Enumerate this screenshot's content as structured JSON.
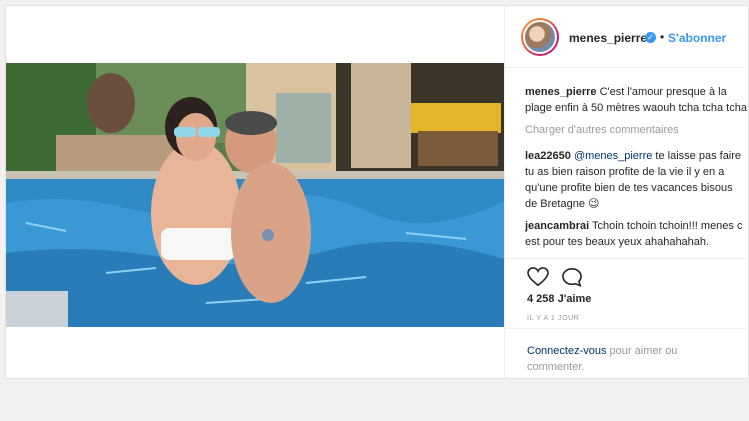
{
  "post": {
    "username": "menes_pierre",
    "follow_label": "S'abonner",
    "separator": "•",
    "verified_glyph": "✓",
    "icons": {
      "avatar": "avatar-image",
      "verified": "verified-badge-icon",
      "like": "heart-icon",
      "comment": "comment-bubble-icon",
      "save": "bookmark-icon",
      "more": "more-options-icon"
    },
    "caption": {
      "author": "menes_pierre",
      "text": " C'est l'amour presque à la plage enfin à 50 mètres waouh tcha tcha tcha"
    },
    "load_more_label": "Charger d'autres commentaires",
    "comments": [
      {
        "author": "lea22650",
        "mention": " @menes_pierre",
        "text": " te laisse pas faire tu as bien raison profite de la vie il y en a qu'une profite bien de tes vacances bisous de Bretagne 😉"
      },
      {
        "author": "jeancambrai",
        "mention": "",
        "text": " Tchoin tchoin tchoin!!! menes c est pour tes beaux yeux ahahahahah."
      }
    ],
    "likes_text": "4 258 J'aime",
    "timestamp": "IL Y A 1 JOUR",
    "login": {
      "link_label": "Connectez-vous",
      "rest_text": " pour aimer ou commenter."
    },
    "more_glyph": "•",
    "colors": {
      "link_blue": "#3897f0",
      "dark_link": "#003569",
      "muted": "#999999",
      "text": "#262626",
      "pool_water": "#2f8ac6"
    }
  }
}
